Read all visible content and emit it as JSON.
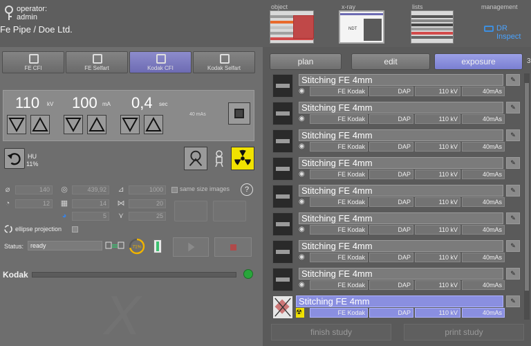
{
  "header": {
    "operator_label": "operator:",
    "operator_name": "admin",
    "company": "Fe Pipe / Doe Ltd.",
    "sections": [
      "object",
      "x-ray",
      "lists",
      "management"
    ],
    "xray_thumb_text": "NDT",
    "brand": "DR Inspect",
    "icons": [
      "key-icon",
      "brand-icon"
    ]
  },
  "devices": [
    {
      "label": "FE CFI",
      "active": false
    },
    {
      "label": "FE Selfart",
      "active": false
    },
    {
      "label": "Kodak CFI",
      "active": true
    },
    {
      "label": "Kodak Selfart",
      "active": false
    }
  ],
  "exposure_params": {
    "kv": {
      "value": "110",
      "unit": "kV"
    },
    "ma": {
      "value": "100",
      "unit": "mA"
    },
    "sec": {
      "value": "0,4",
      "unit": "sec"
    },
    "mas_small": "40 mAs"
  },
  "hu": {
    "label": "HU",
    "value": "11%"
  },
  "stats": {
    "diameter": "140",
    "rotation": "439,92",
    "distance": "1000",
    "same_size_label": "same size images",
    "angle": "12",
    "frames": "14",
    "width": "20",
    "segment": "5",
    "height": "25",
    "ellipse_label": "ellipse projection"
  },
  "status": {
    "label": "Status:",
    "value": "ready",
    "progress_percent": 71,
    "progress_text": "71%"
  },
  "kodak": {
    "label": "Kodak"
  },
  "tabs": [
    {
      "label": "plan",
      "active": false
    },
    {
      "label": "edit",
      "active": false
    },
    {
      "label": "exposure",
      "active": true
    }
  ],
  "tab_overflow": "3",
  "list_items": [
    {
      "title": "Stitching FE 4mm",
      "device": "FE Kodak",
      "type": "DAP",
      "kv": "110 kV",
      "mas": "40mAs",
      "selected": false
    },
    {
      "title": "Stitching FE 4mm",
      "device": "FE Kodak",
      "type": "DAP",
      "kv": "110 kV",
      "mas": "40mAs",
      "selected": false
    },
    {
      "title": "Stitching FE 4mm",
      "device": "FE Kodak",
      "type": "DAP",
      "kv": "110 kV",
      "mas": "40mAs",
      "selected": false
    },
    {
      "title": "Stitching FE 4mm",
      "device": "FE Kodak",
      "type": "DAP",
      "kv": "110 kV",
      "mas": "40mAs",
      "selected": false
    },
    {
      "title": "Stitching FE 4mm",
      "device": "FE Kodak",
      "type": "DAP",
      "kv": "110 kV",
      "mas": "40mAs",
      "selected": false
    },
    {
      "title": "Stitching FE 4mm",
      "device": "FE Kodak",
      "type": "DAP",
      "kv": "110 kV",
      "mas": "40mAs",
      "selected": false
    },
    {
      "title": "Stitching FE 4mm",
      "device": "FE Kodak",
      "type": "DAP",
      "kv": "110 kV",
      "mas": "40mAs",
      "selected": false
    },
    {
      "title": "Stitching FE 4mm",
      "device": "FE Kodak",
      "type": "DAP",
      "kv": "110 kV",
      "mas": "40mAs",
      "selected": false
    },
    {
      "title": "Stitching FE 4mm",
      "device": "FE Kodak",
      "type": "DAP",
      "kv": "110 kV",
      "mas": "40mAs",
      "selected": true
    }
  ],
  "bottom": {
    "finish_label": "finish study",
    "print_label": "print study"
  },
  "colors": {
    "accent": "#7a7fd2",
    "radiation": "#f1e200",
    "led": "#29a63b",
    "progress": "#f0b400"
  }
}
